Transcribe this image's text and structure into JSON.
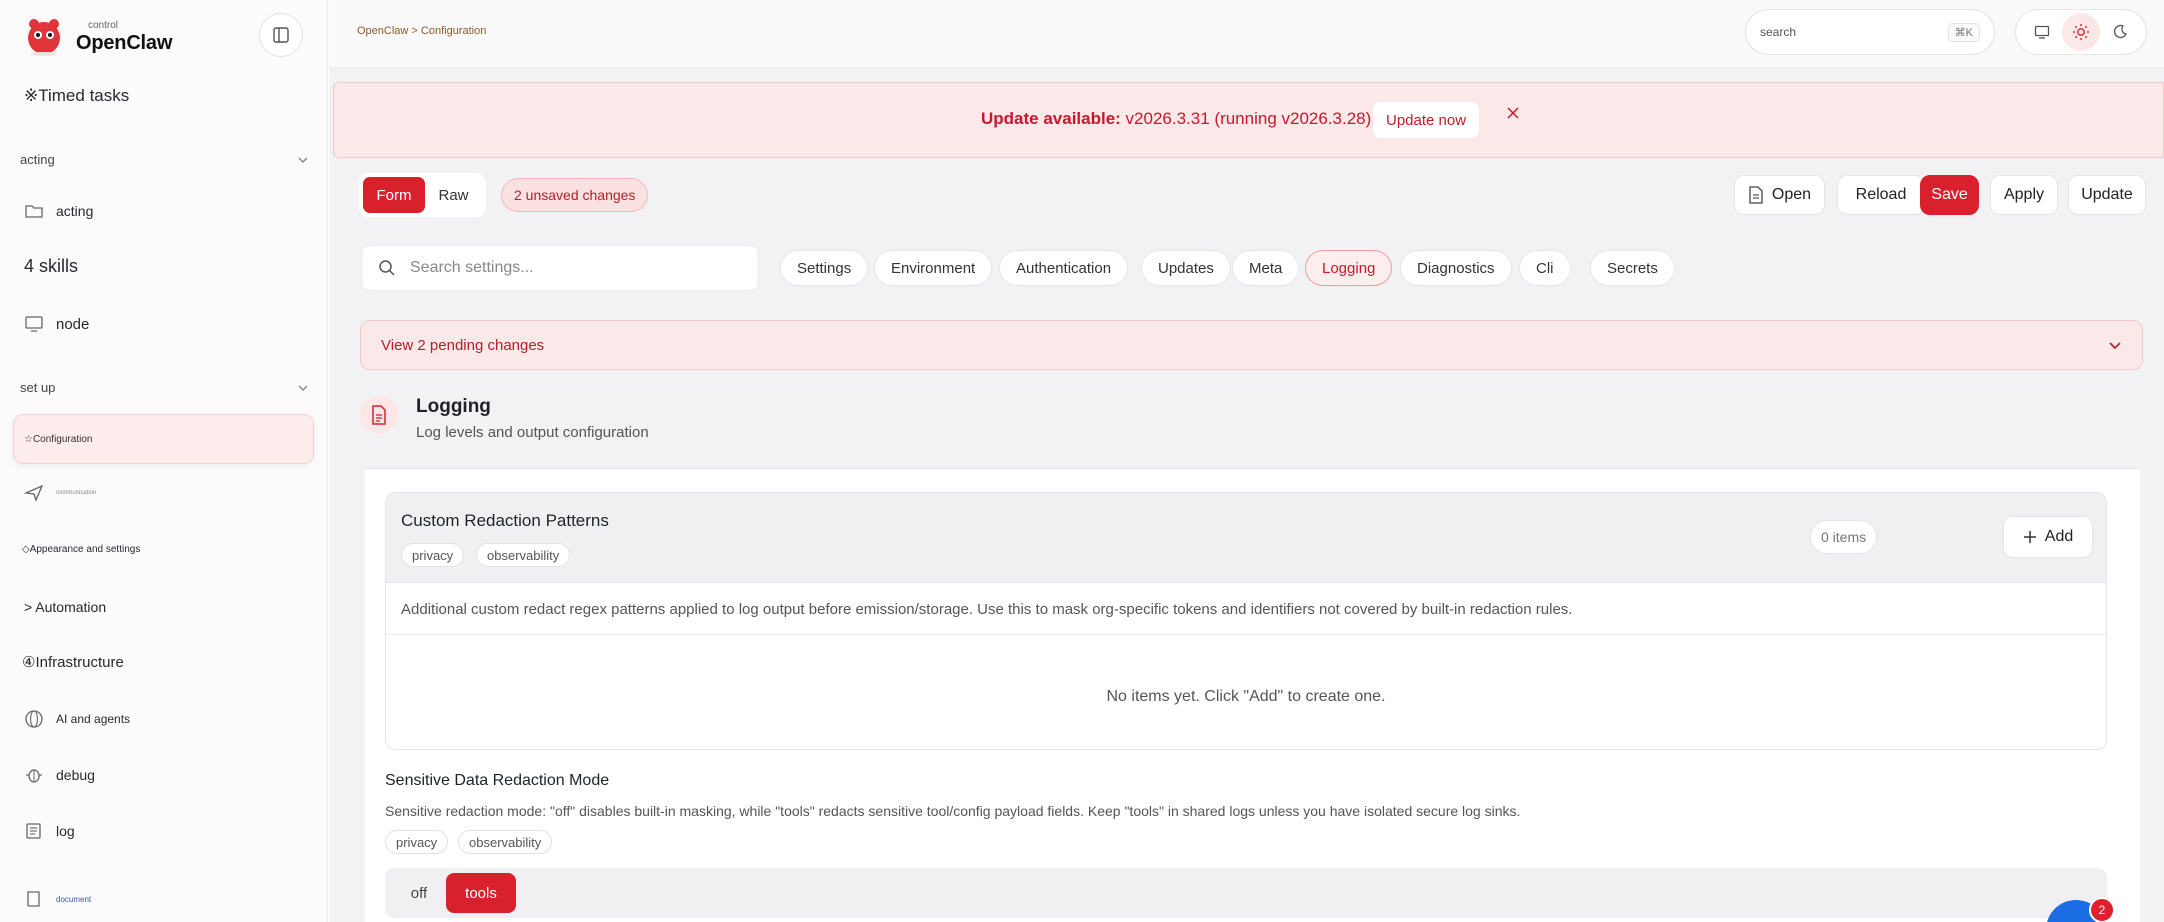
{
  "app": {
    "brand_small": "control",
    "brand_name": "OpenClaw"
  },
  "sidebar": {
    "timed_tasks": "※Timed tasks",
    "acting_section": "acting",
    "acting_item": "acting",
    "skills": "4 skills",
    "node": "node",
    "setup_section": "set up",
    "configuration": "☆Configuration",
    "communication": "communication",
    "appearance": "◇Appearance and settings",
    "automation": "> Automation",
    "infrastructure": "④Infrastructure",
    "ai_agents": "AI and agents",
    "debug": "debug",
    "log": "log",
    "document": "document"
  },
  "topbar": {
    "breadcrumb": "OpenClaw > Configuration",
    "search_placeholder": "search",
    "search_shortcut": "⌘K"
  },
  "banner": {
    "label": "Update available:",
    "version_text": " v2026.3.31 (running v2026.3.28).",
    "update_now": "Update now"
  },
  "toolbar": {
    "mode_form": "Form",
    "mode_raw": "Raw",
    "unsaved": "2 unsaved changes",
    "open": "Open",
    "reload": "Reload",
    "save": "Save",
    "apply": "Apply",
    "update": "Update"
  },
  "filters": {
    "search_placeholder": "Search settings...",
    "chips": [
      "Settings",
      "Environment",
      "Authentication",
      "Updates",
      "Meta",
      "Logging",
      "Diagnostics",
      "Cli",
      "Secrets"
    ],
    "active_chip": "Logging"
  },
  "pending": {
    "label": "View 2 pending changes"
  },
  "section": {
    "title": "Logging",
    "subtitle": "Log levels and output configuration"
  },
  "redaction_card": {
    "title": "Custom Redaction Patterns",
    "tags": [
      "privacy",
      "observability"
    ],
    "count": "0 items",
    "add": "Add",
    "description": "Additional custom redact regex patterns applied to log output before emission/storage. Use this to mask org-specific tokens and identifiers not covered by built-in redaction rules.",
    "empty": "No items yet. Click \"Add\" to create one."
  },
  "redaction_mode": {
    "title": "Sensitive Data Redaction Mode",
    "description": "Sensitive redaction mode: \"off\" disables built-in masking, while \"tools\" redacts sensitive tool/config payload fields. Keep \"tools\" in shared logs unless you have isolated secure log sinks.",
    "tags": [
      "privacy",
      "observability"
    ],
    "options": [
      "off",
      "tools"
    ],
    "selected": "tools"
  },
  "fab": {
    "badge": "2"
  },
  "colors": {
    "accent": "#d9212e",
    "accent_light": "#fbe9ea",
    "fab": "#1a6de3"
  }
}
